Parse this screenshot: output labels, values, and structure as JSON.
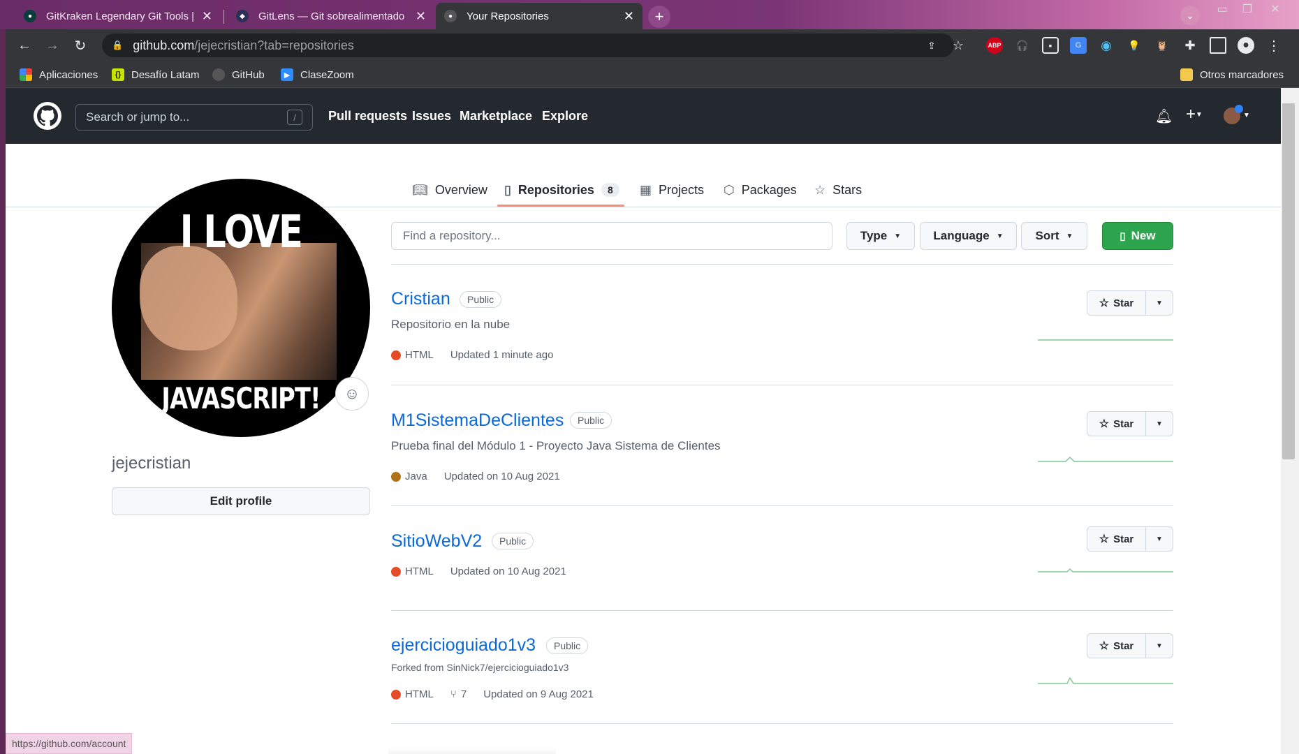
{
  "browser": {
    "tabs": [
      {
        "title": "GitKraken Legendary Git Tools | G",
        "active": false
      },
      {
        "title": "GitLens — Git sobrealimentado",
        "active": false
      },
      {
        "title": "Your Repositories",
        "active": true
      }
    ],
    "url": {
      "host": "github.com",
      "path": "/jejecristian?tab=repositories"
    },
    "bookmarks": [
      "Aplicaciones",
      "Desafío Latam",
      "GitHub",
      "ClaseZoom"
    ],
    "other_bookmarks": "Otros marcadores",
    "extensions": [
      "share-icon",
      "star-icon",
      "abp-icon",
      "headphones-icon",
      "media-icon",
      "translate-icon",
      "circle-icon",
      "bulb-icon",
      "owl-icon",
      "puzzle-icon",
      "sidepanel-icon",
      "profile-icon",
      "menu-icon"
    ],
    "abp_label": "ABP",
    "status_url": "https://github.com/account"
  },
  "header": {
    "search_placeholder": "Search or jump to...",
    "search_shortcut": "/",
    "nav": [
      "Pull requests",
      "Issues",
      "Marketplace",
      "Explore"
    ]
  },
  "profile_tabs": [
    {
      "label": "Overview",
      "icon": "book-icon"
    },
    {
      "label": "Repositories",
      "icon": "repo-icon",
      "count": "8",
      "selected": true
    },
    {
      "label": "Projects",
      "icon": "table-icon"
    },
    {
      "label": "Packages",
      "icon": "package-icon"
    },
    {
      "label": "Stars",
      "icon": "star-icon"
    }
  ],
  "profile": {
    "avatar_text_top": "I LOVE",
    "avatar_text_bottom": "JAVASCRIPT!",
    "username": "jejecristian",
    "edit_label": "Edit profile"
  },
  "filters": {
    "find_placeholder": "Find a repository...",
    "type": "Type",
    "language": "Language",
    "sort": "Sort",
    "new": "New"
  },
  "repos": [
    {
      "name": "Cristian",
      "visibility": "Public",
      "description": "Repositorio en la nube",
      "language": "HTML",
      "lang_color": "#e34c26",
      "updated": "Updated 1 minute ago",
      "star": "Star"
    },
    {
      "name": "M1SistemaDeClientes",
      "visibility": "Public",
      "description": "Prueba final del Módulo 1 - Proyecto Java Sistema de Clientes",
      "language": "Java",
      "lang_color": "#b07219",
      "updated": "Updated on 10 Aug 2021",
      "star": "Star"
    },
    {
      "name": "SitioWebV2",
      "visibility": "Public",
      "description": "",
      "language": "HTML",
      "lang_color": "#e34c26",
      "updated": "Updated on 10 Aug 2021",
      "star": "Star"
    },
    {
      "name": "ejercicioguiado1v3",
      "visibility": "Public",
      "forked_from": "Forked from SinNick7/ejercicioguiado1v3",
      "language": "HTML",
      "lang_color": "#e34c26",
      "forks": "7",
      "updated": "Updated on 9 Aug 2021",
      "star": "Star"
    }
  ],
  "colors": {
    "accent_green": "#2da44e",
    "link_blue": "#0969da",
    "tab_underline": "#fd8c73",
    "header_bg": "#24292f"
  }
}
